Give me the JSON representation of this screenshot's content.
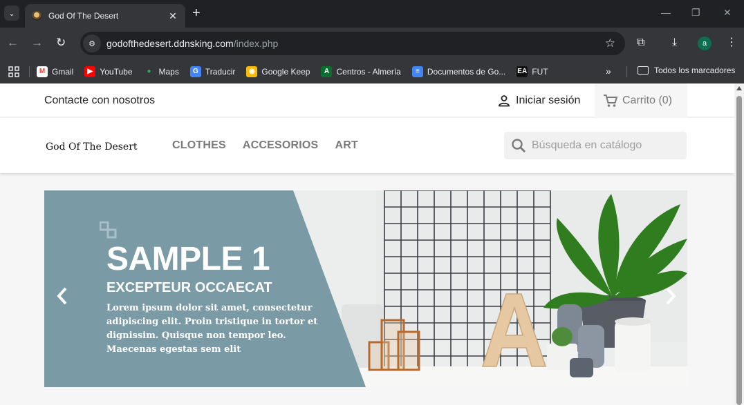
{
  "browser": {
    "tab_title": "God Of The Desert",
    "url_host": "godofthedesert.ddnsking.com",
    "url_path": "/index.php",
    "profile_initial": "a",
    "bookmarks": [
      {
        "label": "Gmail",
        "color": "#ffffff",
        "glyph": "M",
        "glyph_color": "#ea4335"
      },
      {
        "label": "YouTube",
        "color": "#ff0000",
        "glyph": "▶",
        "glyph_color": "#ffffff"
      },
      {
        "label": "Maps",
        "color": "transparent",
        "glyph": "●",
        "glyph_color": "#34a853"
      },
      {
        "label": "Traducir",
        "color": "#4285f4",
        "glyph": "G",
        "glyph_color": "#ffffff"
      },
      {
        "label": "Google Keep",
        "color": "#fbbc04",
        "glyph": "◉",
        "glyph_color": "#ffffff"
      },
      {
        "label": "Centros - Almería",
        "color": "#0b6e2e",
        "glyph": "A",
        "glyph_color": "#ffffff"
      },
      {
        "label": "Documentos de Go...",
        "color": "#4285f4",
        "glyph": "≡",
        "glyph_color": "#ffffff"
      },
      {
        "label": "FUT",
        "color": "#111111",
        "glyph": "EA",
        "glyph_color": "#ffffff"
      }
    ],
    "all_bookmarks_label": "Todos los marcadores"
  },
  "header": {
    "contact_label": "Contacte con nosotros",
    "signin_label": "Iniciar sesión",
    "cart_label": "Carrito (0)",
    "logo_text": "God Of The Desert",
    "menu": [
      "CLOTHES",
      "ACCESORIOS",
      "ART"
    ],
    "search_placeholder": "Búsqueda en catálogo"
  },
  "carousel": {
    "title": "SAMPLE 1",
    "subtitle": "EXCEPTEUR OCCAECAT",
    "description": "Lorem ipsum dolor sit amet, consectetur adipiscing elit. Proin tristique in tortor et dignissim. Quisque non tempor leo. Maecenas egestas sem elit",
    "panel_color": "#7a9aa6"
  }
}
